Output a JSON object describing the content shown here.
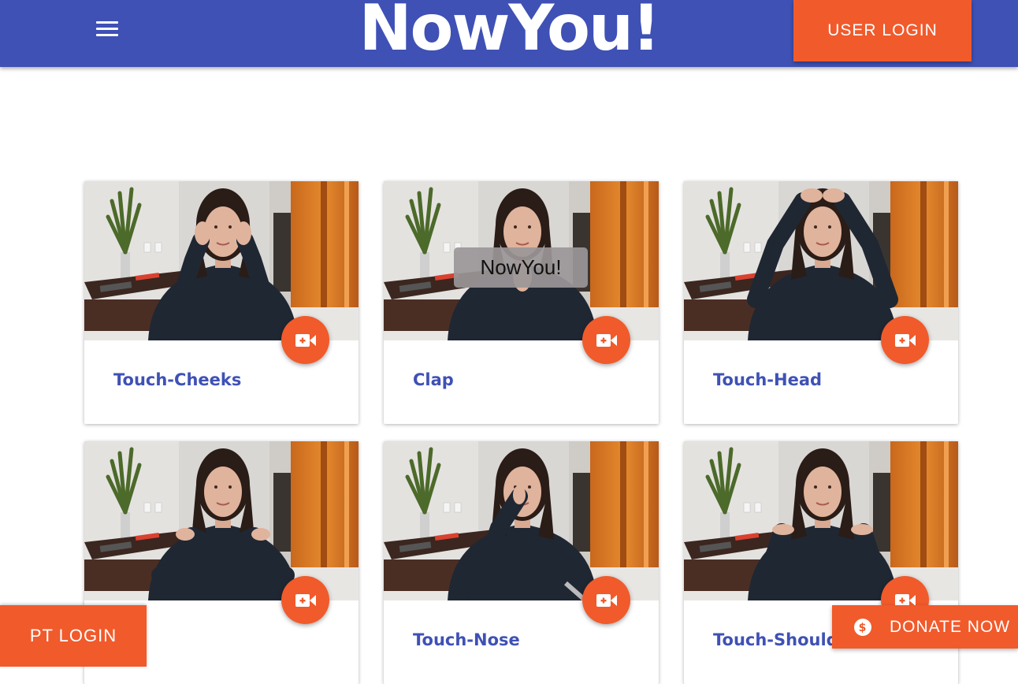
{
  "header": {
    "brand": "NowYou!",
    "user_login_label": "USER LOGIN",
    "menu_icon": "hamburger-menu-icon"
  },
  "exercises": [
    {
      "title": "Touch-Cheeks",
      "pose": "cheeks",
      "action_icon": "video-camera-icon"
    },
    {
      "title": "Clap",
      "pose": "clap",
      "action_icon": "video-camera-icon"
    },
    {
      "title": "Touch-Head",
      "pose": "head",
      "action_icon": "video-camera-icon"
    },
    {
      "title": "",
      "pose": "cross",
      "action_icon": "video-camera-icon"
    },
    {
      "title": "Touch-Nose",
      "pose": "nose",
      "action_icon": "video-camera-icon"
    },
    {
      "title": "Touch-Should",
      "pose": "shoulders",
      "action_icon": "video-camera-icon"
    }
  ],
  "tooltip": {
    "text": "NowYou!"
  },
  "footer": {
    "pt_login_label": "PT LOGIN",
    "donate_label": "DONATE NOW",
    "donate_icon": "dollar-circle-icon"
  },
  "colors": {
    "primary": "#3f51b5",
    "accent": "#f15a2b"
  }
}
